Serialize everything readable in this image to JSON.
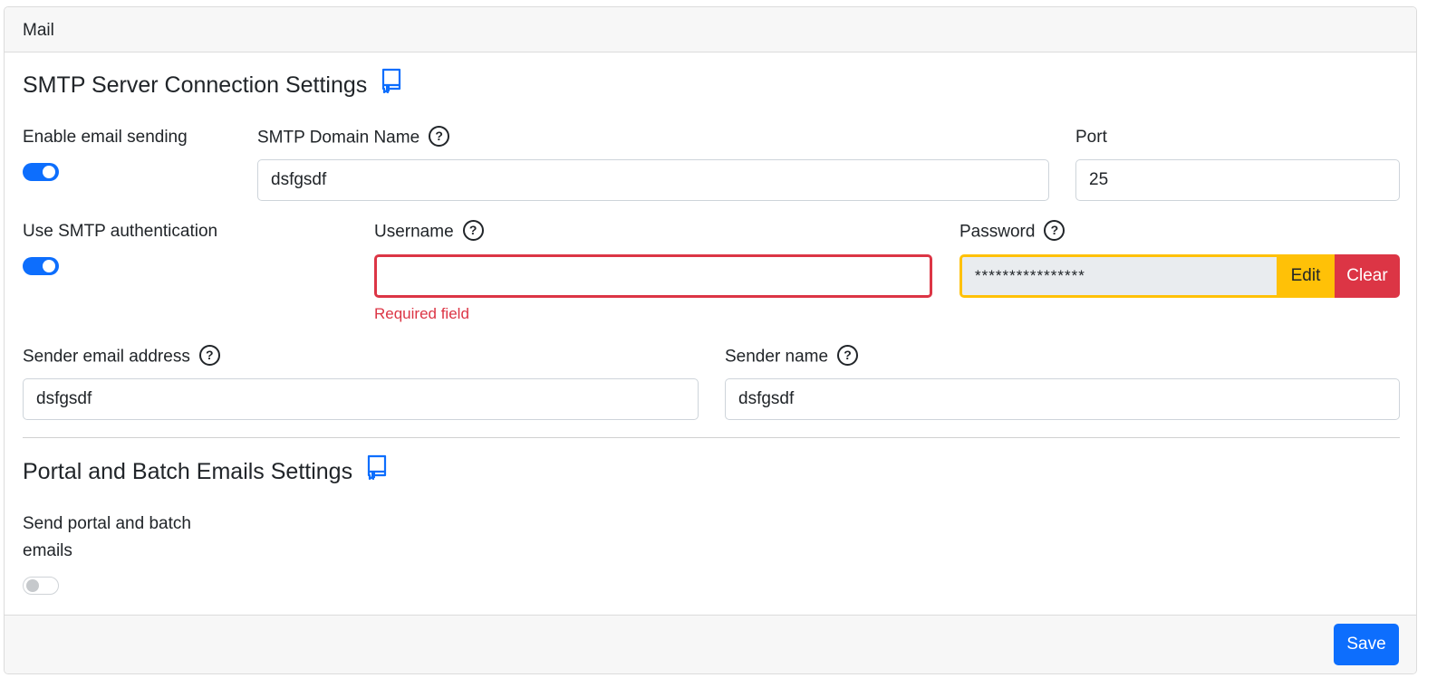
{
  "card": {
    "header_title": "Mail"
  },
  "smtp": {
    "title": "SMTP Server Connection Settings",
    "enable_sending": {
      "label": "Enable email sending",
      "checked": true
    },
    "domain": {
      "label": "SMTP Domain Name",
      "value": "dsfgsdf"
    },
    "port": {
      "label": "Port",
      "value": "25"
    },
    "use_auth": {
      "label": "Use SMTP authentication",
      "checked": true
    },
    "username": {
      "label": "Username",
      "value": "",
      "error": "Required field"
    },
    "password": {
      "label": "Password",
      "value": "****************",
      "edit_label": "Edit",
      "clear_label": "Clear"
    },
    "sender_email": {
      "label": "Sender email address",
      "value": "dsfgsdf"
    },
    "sender_name": {
      "label": "Sender name",
      "value": "dsfgsdf"
    }
  },
  "portal": {
    "title": "Portal and Batch Emails Settings",
    "send_emails": {
      "label": "Send portal and batch emails",
      "checked": false
    }
  },
  "footer": {
    "save_label": "Save"
  },
  "icons": {
    "help": "question-circle-icon",
    "docs": "book-icon"
  },
  "colors": {
    "primary": "#0d6efd",
    "danger": "#dc3545",
    "warning": "#ffc107"
  }
}
